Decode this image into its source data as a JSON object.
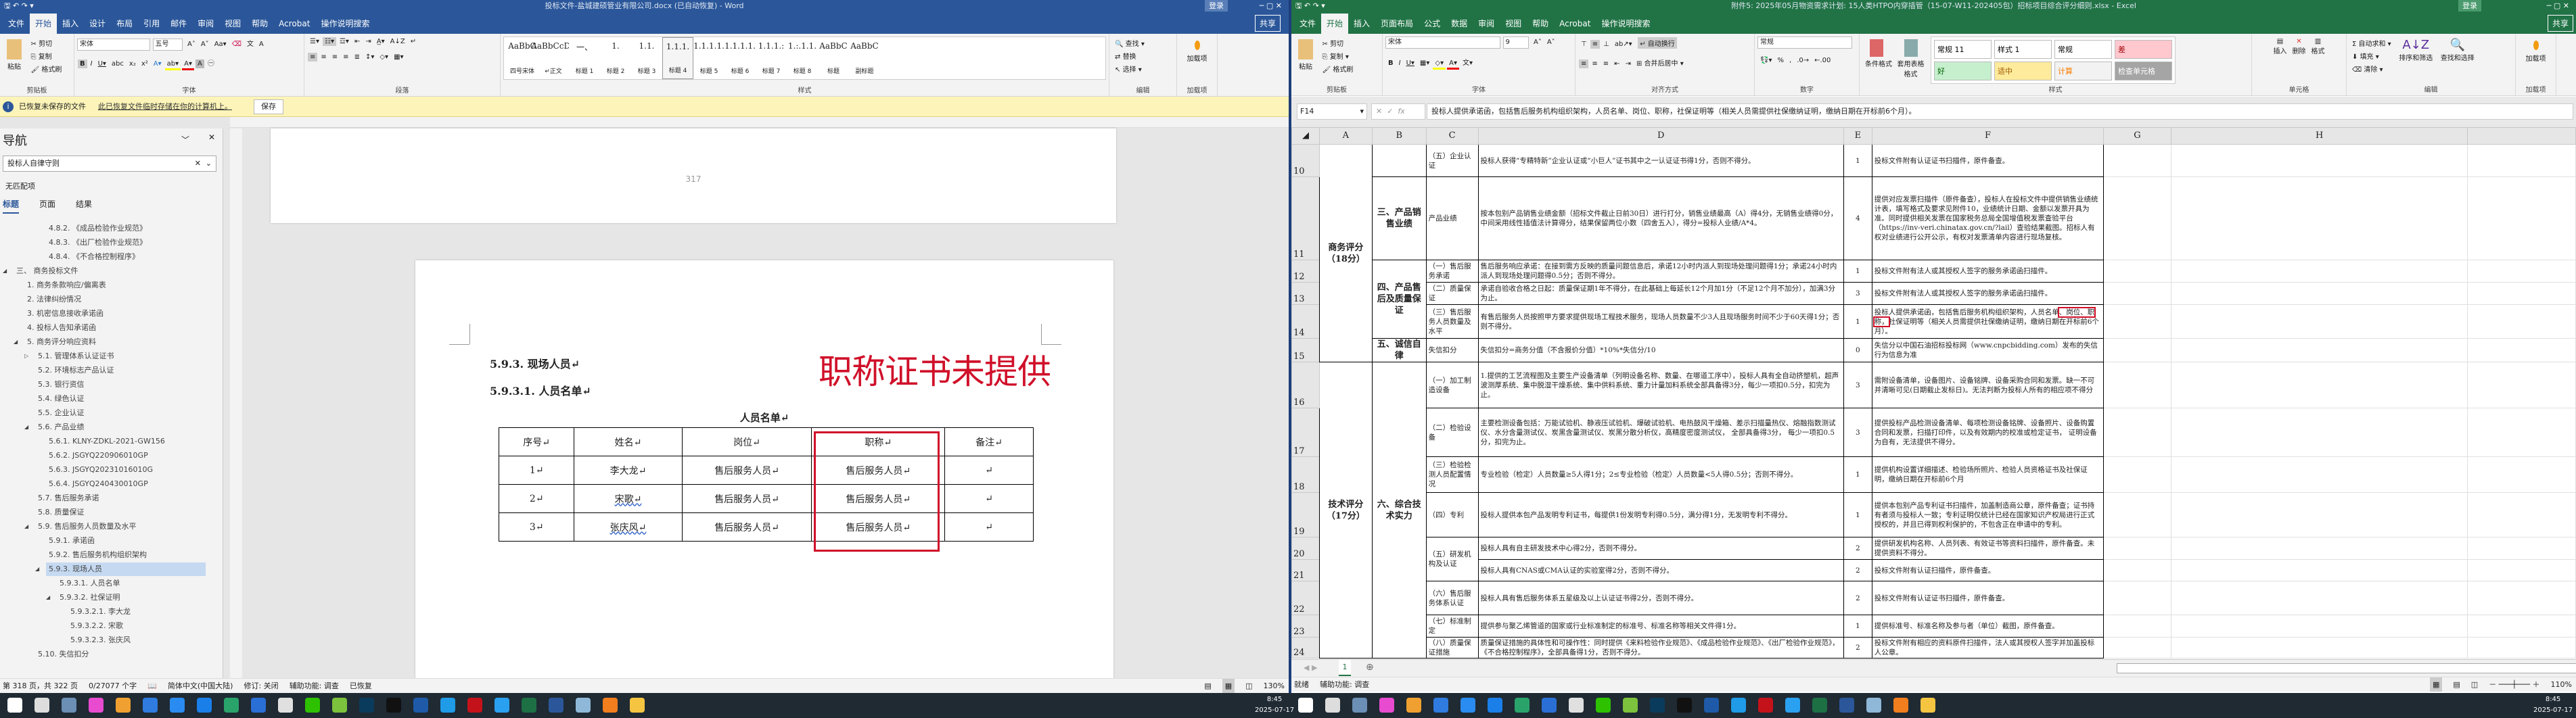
{
  "word": {
    "title": "投标文件-盐城建硕管业有限公司.docx (已自动恢复) - Word",
    "sign_in": "登录",
    "share": "共享",
    "tabs": [
      "文件",
      "开始",
      "插入",
      "设计",
      "布局",
      "引用",
      "邮件",
      "审阅",
      "视图",
      "帮助",
      "Acrobat",
      "操作说明搜索"
    ],
    "ribbon": {
      "clipboard": {
        "paste": "粘贴",
        "cut": "剪切",
        "copy": "复制",
        "format_painter": "格式刷",
        "label": "剪贴板"
      },
      "font": {
        "name": "宋体",
        "size": "五号",
        "label": "字体"
      },
      "paragraph": {
        "label": "段落"
      },
      "styles": {
        "label": "样式",
        "items": [
          {
            "preview": "AaBbC",
            "name": "四号宋体"
          },
          {
            "preview": "AaBbCcDd",
            "name": "↵正文"
          },
          {
            "preview": "一、",
            "name": "标题 1"
          },
          {
            "preview": "1.",
            "name": "标题 2"
          },
          {
            "preview": "1.1.",
            "name": "标题 3"
          },
          {
            "preview": "1.1.1.",
            "name": "标题 4"
          },
          {
            "preview": "1.1.1.1.",
            "name": "标题 5"
          },
          {
            "preview": "1.1.1.1.",
            "name": "标题 6"
          },
          {
            "preview": "1.1.1.:",
            "name": "标题 7"
          },
          {
            "preview": "1.:.1.1.",
            "name": "标题 8"
          },
          {
            "preview": "AaBbC",
            "name": "标题"
          },
          {
            "preview": "AaBbC",
            "name": "副标题"
          }
        ]
      },
      "editing": {
        "find": "查找",
        "replace": "替换",
        "select": "选择",
        "label": "编辑"
      },
      "addins": {
        "btn": "加载项",
        "label": "加载项"
      }
    },
    "infobar": {
      "title": "已恢复未保存的文件",
      "link": "此已恢复文件临时存储在你的计算机上。",
      "save": "保存"
    },
    "nav": {
      "title": "导航",
      "search": "投标人自律守则",
      "no_match": "无匹配项",
      "tabs": [
        "标题",
        "页面",
        "结果"
      ],
      "items": [
        {
          "t": "4.8.2.  《成品检验作业规范》",
          "l": 4
        },
        {
          "t": "4.8.3.  《出厂检验作业规范》",
          "l": 4
        },
        {
          "t": "4.8.4.  《不合格控制程序》",
          "l": 4
        },
        {
          "t": "三、  商务投标文件",
          "l": 1,
          "ex": "◢"
        },
        {
          "t": "1. 商务条款响应/偏离表",
          "l": 2
        },
        {
          "t": "2. 法律纠纷情况",
          "l": 2
        },
        {
          "t": "3. 机密信息接收承诺函",
          "l": 2
        },
        {
          "t": "4. 投标人告知承诺函",
          "l": 2
        },
        {
          "t": "5. 商务评分响应资料",
          "l": 2,
          "ex": "◢"
        },
        {
          "t": "5.1. 管理体系认证证书",
          "l": 3,
          "ex": "▷"
        },
        {
          "t": "5.2. 环境标志产品认证",
          "l": 3
        },
        {
          "t": "5.3. 银行资信",
          "l": 3
        },
        {
          "t": "5.4. 绿色认证",
          "l": 3
        },
        {
          "t": "5.5. 企业认证",
          "l": 3
        },
        {
          "t": "5.6. 产品业绩",
          "l": 3,
          "ex": "◢"
        },
        {
          "t": "5.6.1. KLNY-ZDKL-2021-GW156",
          "l": 4
        },
        {
          "t": "5.6.2. JSGYQ220906010GP",
          "l": 4
        },
        {
          "t": "5.6.3. JSGYQ20231016010G",
          "l": 4
        },
        {
          "t": "5.6.4. JSGYQ240430010GP",
          "l": 4
        },
        {
          "t": "5.7. 售后服务承诺",
          "l": 3
        },
        {
          "t": "5.8. 质量保证",
          "l": 3
        },
        {
          "t": "5.9. 售后服务人员数量及水平",
          "l": 3,
          "ex": "◢"
        },
        {
          "t": "5.9.1. 承诺函",
          "l": 4
        },
        {
          "t": "5.9.2. 售后服务机构组织架构",
          "l": 4
        },
        {
          "t": "5.9.3. 现场人员",
          "l": 4,
          "ex": "◢",
          "sel": true
        },
        {
          "t": "5.9.3.1. 人员名单",
          "l": 5
        },
        {
          "t": "5.9.3.2. 社保证明",
          "l": 5,
          "ex": "◢"
        },
        {
          "t": "5.9.3.2.1. 李大龙",
          "l": 6
        },
        {
          "t": "5.9.3.2.2. 宋歌",
          "l": 6
        },
        {
          "t": "5.9.3.2.3. 张庆风",
          "l": 6
        },
        {
          "t": "5.10. 失信扣分",
          "l": 3
        }
      ]
    },
    "doc": {
      "prev_page_number": "317",
      "heading1": "5.9.3. 现场人员↵",
      "heading2": "5.9.3.1. 人员名单↵",
      "table_caption": "人员名单↵",
      "annotation": "职称证书未提供",
      "table": {
        "headers": [
          "序号↵",
          "姓名↵",
          "岗位↵",
          "职称↵",
          "备注↵"
        ],
        "rows": [
          [
            "1↵",
            "李大龙↵",
            "售后服务人员↵",
            "售后服务人员↵",
            "↵"
          ],
          [
            "2↵",
            "宋歌↵",
            "售后服务人员↵",
            "售后服务人员↵",
            "↵"
          ],
          [
            "3↵",
            "张庆风↵",
            "售后服务人员↵",
            "售后服务人员↵",
            "↵"
          ]
        ]
      }
    },
    "status": {
      "page": "第 318 页，共 322 页",
      "words": "0/27077 个字",
      "lang": "简体中文(中国大陆)",
      "track": "修订: 关闭",
      "access": "辅助功能: 调查",
      "recovered": "已恢复",
      "zoom": "130%"
    }
  },
  "excel": {
    "title": "附件5: 2025年05月物资需求计划: 15人类HTPO内穿插管（15-07-W11-202405包）招标项目综合评分细则.xlsx - Excel",
    "sign_in": "登录",
    "share": "共享",
    "tabs": [
      "文件",
      "开始",
      "插入",
      "页面布局",
      "公式",
      "数据",
      "审阅",
      "视图",
      "帮助",
      "Acrobat",
      "操作说明搜索"
    ],
    "ribbon": {
      "clipboard": {
        "paste": "粘贴",
        "cut": "剪切",
        "copy": "复制",
        "format_painter": "格式刷",
        "label": "剪贴板"
      },
      "font": {
        "name": "宋体",
        "size": "9",
        "label": "字体"
      },
      "align": {
        "wrap": "自动换行",
        "merge": "合并后居中",
        "label": "对齐方式"
      },
      "number": {
        "format": "常规",
        "label": "数字"
      },
      "styles": {
        "cond": "条件格式",
        "table": "套用表格格式",
        "cells": [
          {
            "name": "常规 11",
            "bg": "#ffffff",
            "fg": "#000"
          },
          {
            "name": "样式 1",
            "bg": "#ffffff",
            "fg": "#000"
          },
          {
            "name": "常规",
            "bg": "#ffffff",
            "fg": "#000"
          },
          {
            "name": "差",
            "bg": "#ffc7ce",
            "fg": "#9c0006"
          },
          {
            "name": "好",
            "bg": "#c6efce",
            "fg": "#006100"
          },
          {
            "name": "适中",
            "bg": "#ffeb9c",
            "fg": "#9c5700"
          },
          {
            "name": "计算",
            "bg": "#f2f2f2",
            "fg": "#fa7d00"
          },
          {
            "name": "检查单元格",
            "bg": "#a5a5a5",
            "fg": "#ffffff"
          }
        ],
        "label": "样式"
      },
      "cells": {
        "insert": "插入",
        "delete": "删除",
        "format": "格式",
        "label": "单元格"
      },
      "editing": {
        "autosum": "自动求和",
        "fill": "填充",
        "clear": "清除",
        "sort": "排序和筛选",
        "find": "查找和选择",
        "label": "编辑"
      },
      "addins": {
        "btn": "加载项",
        "label": "加载项"
      }
    },
    "name_box": "F14",
    "formula": "投标人提供承诺函，包括售后服务机构组织架构，人员名单、岗位、职称，社保证明等（相关人员需提供社保缴纳证明，缴纳日期在开标前6个月）。",
    "columns": [
      "A",
      "B",
      "C",
      "D",
      "E",
      "F",
      "G",
      "H"
    ],
    "rows": [
      {
        "n": "10",
        "A": "商务评分（18分）",
        "B": "",
        "C": "（五）企业认证",
        "D": "投标人获得“专精特新”企业认证或“小巨人”证书其中之一认证证书得1分，否则不得分。",
        "E": "1",
        "F": "投标文件附有认证证书扫描件，原件备查。"
      },
      {
        "n": "11",
        "B": "三、产品销售业绩",
        "C": "产品业绩",
        "D": "按本包别产品销售业绩金额（招标文件截止日前30日）进行打分，销售业绩最高（A）得4分，无销售业绩得0分，中间采用线性插值法计算得分，结果保留两位小数（四舍五入），得分=投标人业绩/A*4。",
        "E": "4",
        "F": "提供对应发票扫描件（原件备查），投标人在投标文件中提供销售业绩统计表，填写格式及要求见附件10，业绩统计日期、金额以发票开具为准。同时提供相关发票在国家税务总局全国增值税发票查验平台（https://inv-veri.chinatax.gov.cn/?lail）查验结果截图。招标人有权对业绩进行公开公示，有权对发票清单内容进行现场复核。"
      },
      {
        "n": "12",
        "B": "四、产品售后及质量保证",
        "C": "（一）售后服务承诺",
        "D": "售后服务响应承诺：在接到需方反映的质量问题信息后，承诺12小时内派人到现场处理问题得1分；承诺24小时内派人到现场处理问题得0.5分；否则不得分。",
        "E": "1",
        "F": "投标文件附有法人或其授权人签字的服务承诺函扫描件。"
      },
      {
        "n": "13",
        "C": "（二）质量保证",
        "D": "承诺自验收合格之日起：质量保证期1年不得分，在此基础上每延长12个月加1分（不足12个月不加分），加满3分为止。",
        "E": "3",
        "F": "投标文件附有法人或其授权人签字的服务承诺函扫描件。"
      },
      {
        "n": "14",
        "C": "（三）售后服务人员数量及水平",
        "D": "有售后服务人员按照甲方要求提供现场工程技术服务，现场人员数量不少3人且现场服务时间不少于60天得1分；否则不得分。",
        "E": "1",
        "F_pre": "投标人提供承诺函，包括售后服务机构组织架构，人员名单",
        "F_hl": "、岗位、职称，",
        "F_post": "社保证明等（相关人员需提供社保缴纳证明，缴纳日期在开标前6个月）。"
      },
      {
        "n": "15",
        "B": "五、诚信自律",
        "C": "失信扣分",
        "D": "失信扣分=商务分值（不含报价分值）*10%*失信分/10",
        "E": "0",
        "F": "失信分以中国石油招标投标网（www.cnpcbidding.com）发布的失信行为信息为准"
      },
      {
        "n": "16",
        "A": "技术评分（17分）",
        "B": "六、综合技术实力",
        "C": "（一）加工制造设备",
        "D": "1.提供的工艺流程图及主要生产设备清单（列明设备名称、数量、在哪道工序中），投标人具有全自动挤塑机，超声波测厚系统、集中脱湿干燥系统、集中供料系统、重力计量加料系统全部具备得3分，每少一项扣0.5分，扣完为止。",
        "E": "3",
        "F": "需附设备清单，设备图片、设备铭牌、设备采购合同和发票。缺一不可并清晰可见(日期截止发标日)。无法判断为投标人所有的相应项不得分"
      },
      {
        "n": "17",
        "C": "（二）检验设备",
        "D": "主要检测设备包括：万能试验机、静液压试验机、爆破试验机、电热鼓风干燥箱、差示扫描量热仪、熔融指数测试仪、水分含量测试仪、炭黑含量测试仪、炭黑分散分析仪，高精度密度测试仪， 全部具备得3分， 每少一项扣0.5分，扣完为止。",
        "E": "3",
        "F": "提供投标产品检测设备清单、每项检测设备铭牌、设备照片、设备购置合同和发票，扫描打印件，以及有效期内的校准或检定证书， 证明设备为自有，无法提供不得分。"
      },
      {
        "n": "18",
        "C": "（三）检验检测人员配置情况",
        "D": "专业检验（检定）人员数量≥5人得1分；2≤专业检验（检定）人员数量<5人得0.5分；否则不得分。",
        "E": "1",
        "F": "提供机构设置详细描述、检验场所照片、检验人员资格证书及社保证明，缴纳日期在开标前6个月"
      },
      {
        "n": "19",
        "C": "（四）专利",
        "D": "投标人提供本包产品发明专利证书，每提供1份发明专利得0.5分，满分得1分，无发明专利不得分。",
        "E": "1",
        "F": "提供本包别产品专利证书扫描件，加盖制造商公章，原件备查；证书持有者须与投标人一致；专利证明仅统计已经在国家知识产权局进行正式授权的，并且已得到权利保护的，不包含正在申请中的专利。"
      },
      {
        "n": "20",
        "C": "（五）研发机构及认证",
        "D": "投标人具有自主研发技术中心得2分，否则不得分。",
        "E": "2",
        "F": "提供研发机构名称、人员列表、有效证书等资料扫描件，原件备查。未提供资料不得分。"
      },
      {
        "n": "21",
        "D": "投标人具有CNAS或CMA认证的实验室得2分，否则不得分。",
        "E": "2",
        "F": "投标文件附有认证扫描件，原件备查。"
      },
      {
        "n": "22",
        "C": "（六）售后服务体系认证",
        "D": "投标人具有售后服务体系五星级及以上认证证书得2分，否则不得分。",
        "E": "2",
        "F": "投标文件附有认证证书扫描件，原件备查。"
      },
      {
        "n": "23",
        "C": "（七）标准制定",
        "D": "提供参与聚乙烯管道的国家或行业标准制定的标准号、标准名称等相关文件得1分。",
        "E": "1",
        "F": "提供标准号、标准名称及参与者（单位）截图，原件备查。"
      },
      {
        "n": "24",
        "C": "（八）质量保证措施",
        "D": "质量保证措施的具体性和可操作性：同时提供《来料检验作业规范》、《成品检验作业规范》、《出厂检验作业规范》，《不合格控制程序》，全部具备得1分，否则不得分。",
        "E": "2",
        "F": "投标文件附有相应的资料原件扫描件，法人或其授权人签字并加盖投标人公章。"
      }
    ],
    "sheet_tab": "1",
    "status": {
      "ready": "就绪",
      "access": "辅助功能: 调查",
      "zoom": "110%"
    }
  },
  "taskbar": {
    "time": "8:45",
    "date": "2025-07-17",
    "icons": [
      {
        "name": "start",
        "c": "#ffffff"
      },
      {
        "name": "search",
        "c": "#dddddd"
      },
      {
        "name": "calculator",
        "c": "#6b8fb5"
      },
      {
        "name": "color-picker",
        "c": "#e84bd0"
      },
      {
        "name": "photo-viewer",
        "c": "#f0a030"
      },
      {
        "name": "app-dots",
        "c": "#2f7be0"
      },
      {
        "name": "tencent-docs",
        "c": "#2a8cf0"
      },
      {
        "name": "browser",
        "c": "#1a7fe8"
      },
      {
        "name": "edge-dev",
        "c": "#2aa36b"
      },
      {
        "name": "ie",
        "c": "#2a6fd6"
      },
      {
        "name": "file-tool",
        "c": "#e0e0e0"
      },
      {
        "name": "wechat",
        "c": "#2dc100"
      },
      {
        "name": "ruler-app",
        "c": "#7cc23c"
      },
      {
        "name": "photoshop",
        "c": "#0b3b5c"
      },
      {
        "name": "qq",
        "c": "#111111"
      },
      {
        "name": "xmind",
        "c": "#1e5aa8"
      },
      {
        "name": "qq-browser",
        "c": "#1f9be8"
      },
      {
        "name": "acrobat",
        "c": "#c4121a"
      },
      {
        "name": "browser-2",
        "c": "#2aa0f0"
      },
      {
        "name": "excel",
        "c": "#1d7044"
      },
      {
        "name": "word",
        "c": "#2b579a"
      },
      {
        "name": "notes",
        "c": "#8fb8d8"
      },
      {
        "name": "active-app",
        "c": "#f27e1e"
      },
      {
        "name": "file-explorer",
        "c": "#f5c542"
      }
    ]
  }
}
